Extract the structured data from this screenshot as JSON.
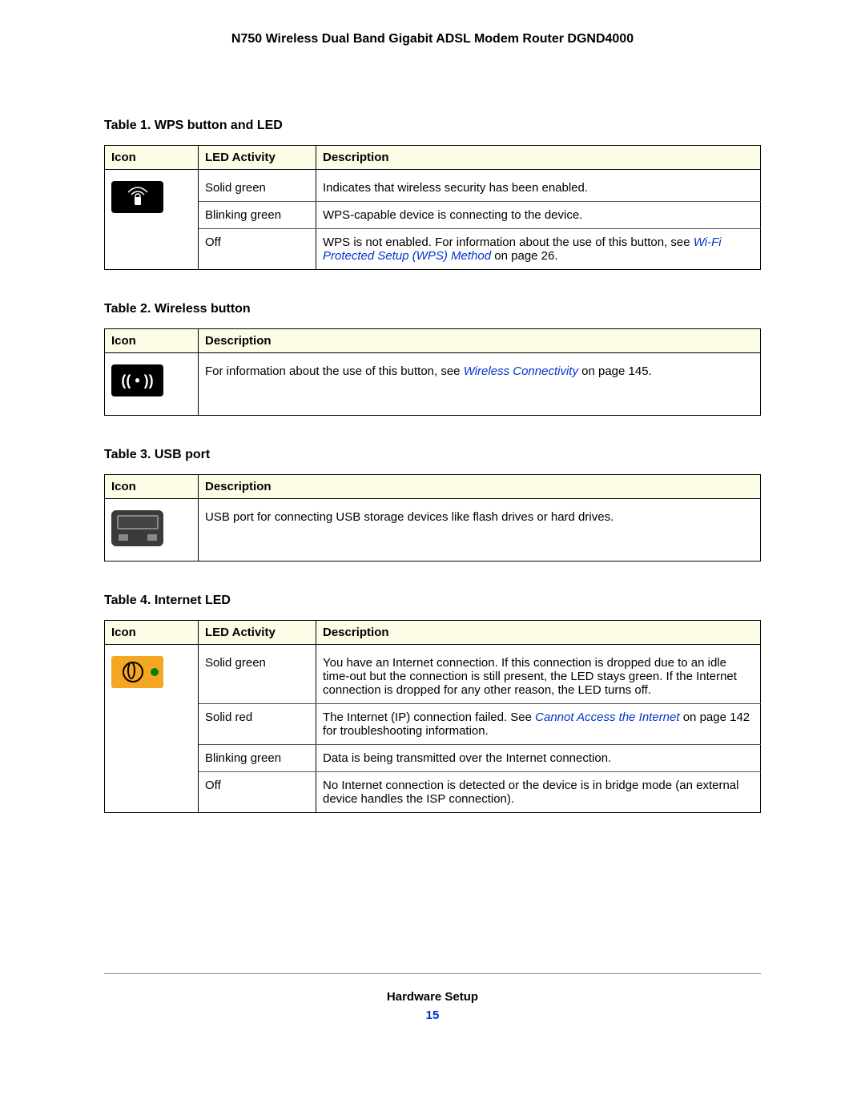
{
  "doc_title": "N750 Wireless Dual Band Gigabit ADSL Modem Router DGND4000",
  "headers": {
    "icon": "Icon",
    "activity": "LED Activity",
    "description": "Description"
  },
  "table1": {
    "caption": "Table 1.  WPS button and LED",
    "rows": [
      {
        "activity": "Solid green",
        "desc": "Indicates that wireless security has been enabled."
      },
      {
        "activity": "Blinking green",
        "desc": "WPS-capable device is connecting to the device."
      },
      {
        "activity": "Off",
        "desc_prefix": "WPS is not enabled. For information about the use of this button, see ",
        "link": "Wi-Fi Protected Setup (WPS) Method",
        "desc_suffix": " on page 26."
      }
    ]
  },
  "table2": {
    "caption": "Table 2.  Wireless button",
    "row": {
      "desc_prefix": "For information about the use of this button, see ",
      "link": "Wireless Connectivity",
      "desc_suffix": " on page 145."
    }
  },
  "table3": {
    "caption": "Table 3.  USB port",
    "row": {
      "desc": "USB port for connecting USB storage devices like flash drives or hard drives."
    }
  },
  "table4": {
    "caption": "Table 4.  Internet LED",
    "rows": [
      {
        "activity": "Solid green",
        "desc": "You have an Internet connection. If this connection is dropped due to an idle time-out but the connection is still present, the LED stays green. If the Internet connection is dropped for any other reason, the LED turns off."
      },
      {
        "activity": "Solid red",
        "desc_prefix": "The Internet (IP) connection failed. See ",
        "link": "Cannot Access the Internet",
        "desc_suffix": " on page 142 for troubleshooting information."
      },
      {
        "activity": "Blinking green",
        "desc": "Data is being transmitted over the Internet connection."
      },
      {
        "activity": "Off",
        "desc": "No Internet connection is detected or the device is in bridge mode (an external device handles the ISP connection)."
      }
    ]
  },
  "footer": {
    "section": "Hardware Setup",
    "page": "15"
  }
}
